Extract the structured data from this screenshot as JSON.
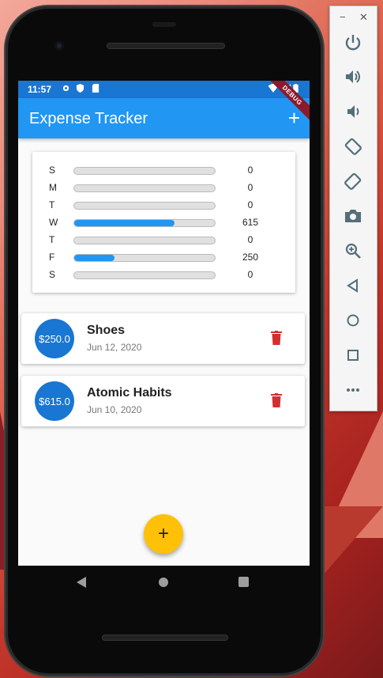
{
  "status_bar": {
    "time": "11:57"
  },
  "app_bar": {
    "title": "Expense Tracker",
    "add_label": "+",
    "debug_banner": "DEBUG"
  },
  "chart_data": {
    "type": "bar",
    "categories": [
      "S",
      "M",
      "T",
      "W",
      "T",
      "F",
      "S"
    ],
    "values": [
      0,
      0,
      0,
      615,
      0,
      250,
      0
    ],
    "value_labels": [
      "0",
      "0",
      "0",
      "615",
      "0",
      "250",
      "0"
    ]
  },
  "transactions": [
    {
      "amount": "$250.0",
      "title": "Shoes",
      "date": "Jun 12, 2020"
    },
    {
      "amount": "$615.0",
      "title": "Atomic Habits",
      "date": "Jun 10, 2020"
    }
  ],
  "fab": {
    "label": "+"
  },
  "emulator_toolbar": {
    "minimize": "−",
    "close": "✕",
    "buttons": [
      "power-icon",
      "volume-up-icon",
      "volume-down-icon",
      "rotate-left-icon",
      "rotate-right-icon",
      "camera-icon",
      "zoom-icon",
      "back-icon",
      "home-icon",
      "overview-icon",
      "more-icon"
    ]
  },
  "colors": {
    "primary": "#2196f3",
    "primary_dark": "#1976d2",
    "accent": "#ffc107",
    "delete": "#d32f2f"
  }
}
